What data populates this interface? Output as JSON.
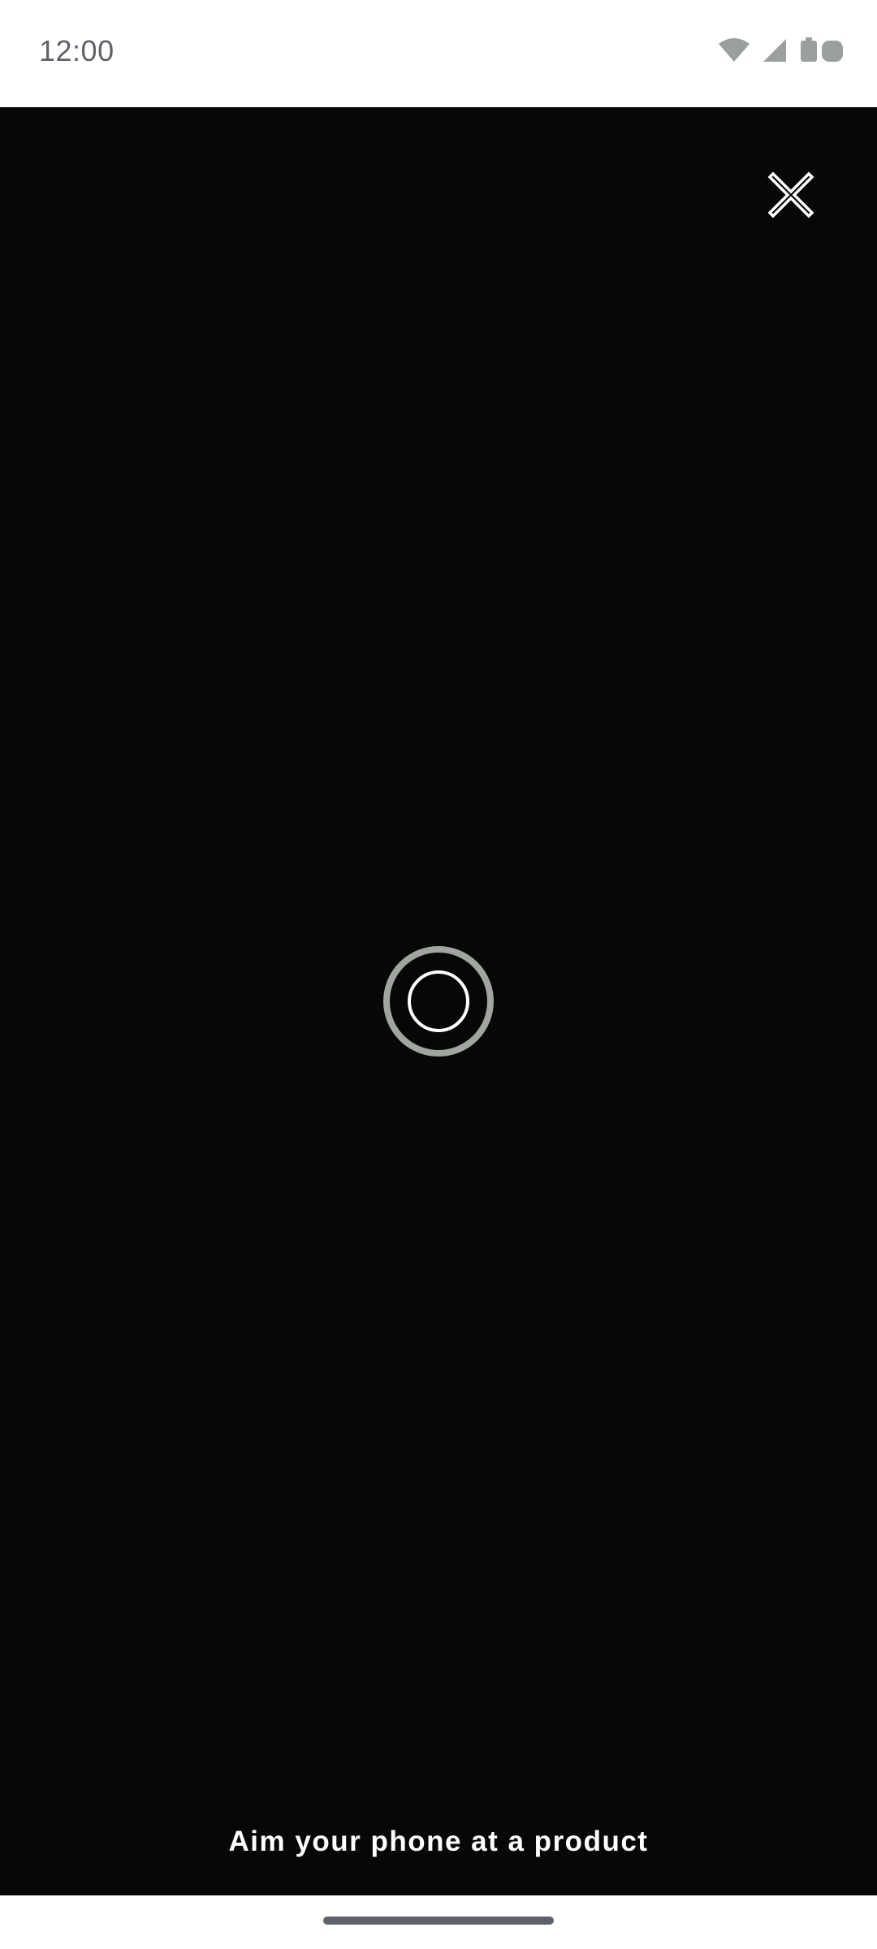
{
  "status_bar": {
    "time": "12:00",
    "icons": [
      "wifi-icon",
      "cellular-signal-icon",
      "battery-icon"
    ],
    "icon_color": "#9aa09b"
  },
  "viewfinder": {
    "background_color": "#070707",
    "close_icon": "close-icon",
    "reticle_icon": "focus-reticle-icon",
    "reticle_outer_color": "#a1a59f",
    "reticle_inner_color": "#ffffff",
    "hint": "Aim your phone at a product"
  },
  "navigation": {
    "home_indicator_color": "#5f6368"
  }
}
